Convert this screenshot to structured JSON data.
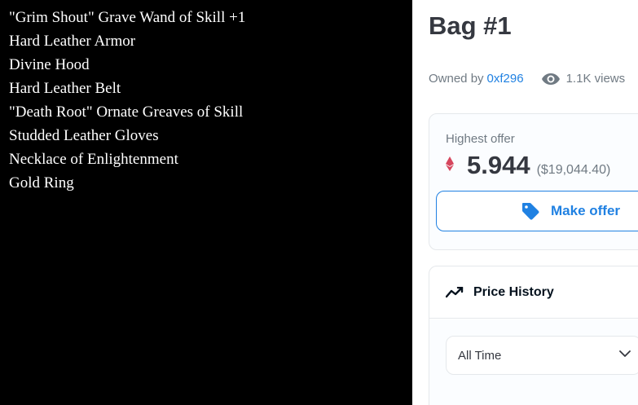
{
  "art": {
    "items": [
      "\"Grim Shout\" Grave Wand of Skill +1",
      "Hard Leather Armor",
      "Divine Hood",
      "Hard Leather Belt",
      "\"Death Root\" Ornate Greaves of Skill",
      "Studded Leather Gloves",
      "Necklace of Enlightenment",
      "Gold Ring"
    ]
  },
  "detail": {
    "title": "Bag #1",
    "owned_prefix": "Owned by",
    "owner": "0xf296",
    "views": "1.1K views"
  },
  "offer": {
    "label": "Highest offer",
    "amount": "5.944",
    "usd": "($19,044.40)",
    "button_label": "Make offer"
  },
  "price_history": {
    "title": "Price History",
    "range_selected": "All Time"
  },
  "colors": {
    "accent": "#2081e2",
    "eth": "#d6475e",
    "text_dark": "#353840",
    "text_muted": "#707a83",
    "border": "#e5e8eb"
  },
  "icons": {
    "eth": "ethereum-icon",
    "views": "eye-icon",
    "offer": "tag-icon",
    "history": "trend-icon",
    "select": "chevron-down-icon"
  }
}
